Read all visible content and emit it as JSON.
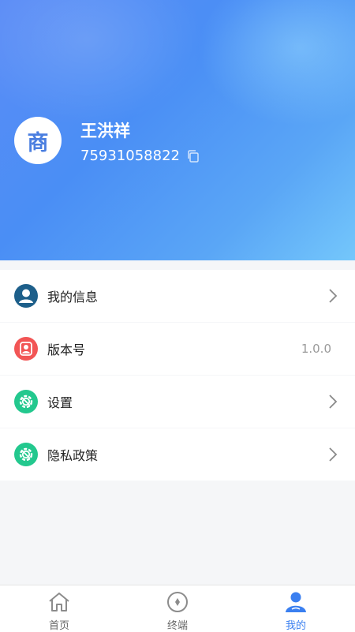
{
  "profile": {
    "avatar_text": "商",
    "name": "王洪祥",
    "user_id": "75931058822"
  },
  "menu": [
    {
      "label": "我的信息",
      "icon": "user-icon",
      "color": "#1d5f8a"
    },
    {
      "label": "版本号",
      "value": "1.0.0",
      "icon": "user-badge-icon",
      "color": "#f25555"
    },
    {
      "label": "设置",
      "icon": "settings-gear-icon",
      "color": "#23c88e"
    },
    {
      "label": "隐私政策",
      "icon": "privacy-gear-icon",
      "color": "#23c88e"
    }
  ],
  "tabs": [
    {
      "label": "首页",
      "icon": "home-icon",
      "active": false
    },
    {
      "label": "终端",
      "icon": "compass-icon",
      "active": false
    },
    {
      "label": "我的",
      "icon": "person-icon",
      "active": true
    }
  ],
  "colors": {
    "accent": "#3a7ff0",
    "header_gradient_start": "#5b8cf6",
    "header_gradient_end": "#74c7fb"
  }
}
